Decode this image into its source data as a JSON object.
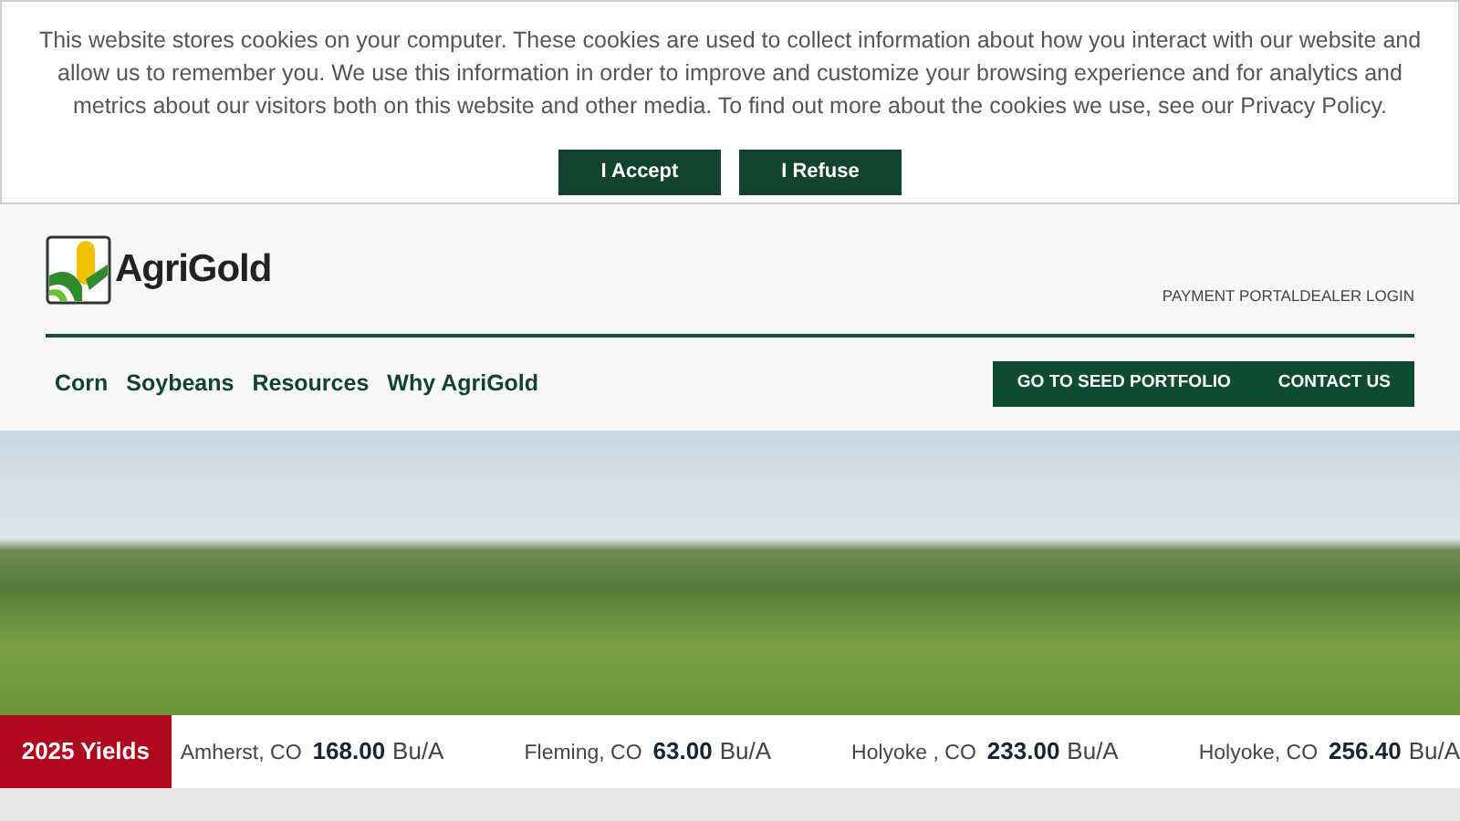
{
  "cookie_banner": {
    "message": "This website stores cookies on your computer. These cookies are used to collect information about how you interact with our website and allow us to remember you. We use this information in order to improve and customize your browsing experience and for analytics and metrics about our visitors both on this website and other media. To find out more about the cookies we use, see our Privacy Policy.",
    "buttons": [
      "I Accept",
      "I Refuse"
    ]
  },
  "header": {
    "logo_text": "AgriGold",
    "utility_links": [
      "PAYMENT PORTAL",
      "DEALER LOGIN"
    ],
    "nav": [
      "Corn",
      "Soybeans",
      "Resources",
      "Why AgriGold"
    ],
    "actions": [
      "GO TO SEED PORTFOLIO",
      "CONTACT US"
    ]
  },
  "yields": {
    "label": "2025 Yields",
    "entries": [
      {
        "location": "Amherst, CO",
        "value": "168.00",
        "unit": "Bu/A"
      },
      {
        "location": "Fleming, CO",
        "value": "63.00",
        "unit": "Bu/A"
      },
      {
        "location": "Holyoke , CO",
        "value": "233.00",
        "unit": "Bu/A"
      },
      {
        "location": "Holyoke, CO",
        "value": "256.40",
        "unit": "Bu/A"
      }
    ]
  }
}
